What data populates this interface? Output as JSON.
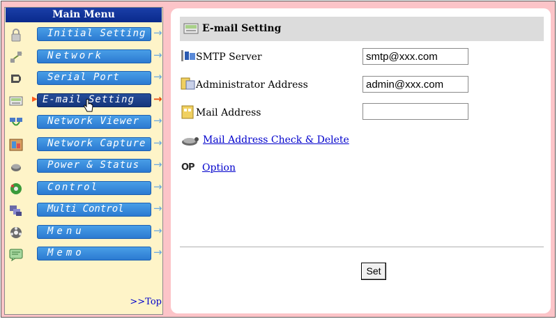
{
  "menu": {
    "title": "Main Menu",
    "items": [
      {
        "label": "Initial Setting",
        "icon": "lock-icon"
      },
      {
        "label": "Network",
        "icon": "network-icon"
      },
      {
        "label": "Serial Port",
        "icon": "serial-port-icon"
      },
      {
        "label": "E-mail Setting",
        "icon": "email-icon",
        "active": true
      },
      {
        "label": "Network Viewer",
        "icon": "network-viewer-icon"
      },
      {
        "label": "Network Capture",
        "icon": "network-capture-icon"
      },
      {
        "label": "Power & Status",
        "icon": "power-icon"
      },
      {
        "label": "Control",
        "icon": "control-icon"
      },
      {
        "label": "Multi Control",
        "icon": "multi-control-icon"
      },
      {
        "label": "Menu",
        "icon": "menu-icon"
      },
      {
        "label": "Memo",
        "icon": "memo-icon"
      }
    ],
    "arrow": "→",
    "top_link": ">>Top"
  },
  "section": {
    "title": "E-mail Setting",
    "fields": [
      {
        "label": "SMTP Server",
        "value": "smtp@xxx.com"
      },
      {
        "label": "Administrator Address",
        "value": "admin@xxx.com"
      },
      {
        "label": "Mail Address",
        "value": ""
      }
    ],
    "check_link": "Mail Address Check & Delete",
    "option_label": "OP",
    "option_link": "Option",
    "set_button": "Set"
  },
  "colors": {
    "menu_button": "#3a8ee0",
    "menu_button_active": "#1f4490",
    "menu_bg": "#fef4c8",
    "frame_bg": "#fcc4c8",
    "title_bar": "#1a3ea8",
    "link": "#0000cc"
  }
}
